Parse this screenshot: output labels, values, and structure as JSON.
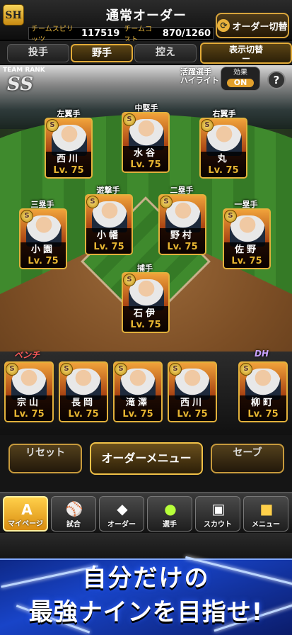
{
  "header": {
    "logo_text": "SH",
    "title": "通常オーダー",
    "team_spirit_label": "チームスピリッツ",
    "team_spirit_value": "117519",
    "team_cost_label": "チームコスト",
    "team_cost_value": "870/1260",
    "order_switch_label": "オーダー切替",
    "order_switch_icon": "cycle-arrows-icon"
  },
  "tabs": [
    {
      "label": "投手",
      "active": false
    },
    {
      "label": "野手",
      "active": true
    },
    {
      "label": "控え",
      "active": false
    }
  ],
  "view_switch": {
    "label": "表示切替",
    "value": "ー"
  },
  "field": {
    "team_rank_label": "TEAM RANK",
    "team_rank_value": "SS",
    "highlight_label_1": "活躍選手",
    "highlight_label_2": "ハイライト",
    "effect_label": "効果",
    "effect_value": "ON",
    "help_label": "?"
  },
  "lineup": [
    {
      "position": "左翼手",
      "name": "西川",
      "level": "Lv. 75"
    },
    {
      "position": "中堅手",
      "name": "水谷",
      "level": "Lv. 75"
    },
    {
      "position": "右翼手",
      "name": "丸",
      "level": "Lv. 75"
    },
    {
      "position": "三塁手",
      "name": "小園",
      "level": "Lv. 75"
    },
    {
      "position": "遊撃手",
      "name": "小幡",
      "level": "Lv. 75"
    },
    {
      "position": "二塁手",
      "name": "野村",
      "level": "Lv. 75"
    },
    {
      "position": "一塁手",
      "name": "佐野",
      "level": "Lv. 75"
    },
    {
      "position": "捕手",
      "name": "石伊",
      "level": "Lv. 75"
    }
  ],
  "bench": {
    "bench_label": "ベンチ",
    "dh_label": "DH",
    "players": [
      {
        "name": "宗山",
        "level": "Lv. 75"
      },
      {
        "name": "長岡",
        "level": "Lv. 75"
      },
      {
        "name": "滝澤",
        "level": "Lv. 75"
      },
      {
        "name": "西川",
        "level": "Lv. 75"
      },
      {
        "name": "柳町",
        "level": "Lv. 75"
      }
    ]
  },
  "badge_letter": "S",
  "actions": {
    "reset_label": "リセット",
    "menu_label": "オーダーメニュー",
    "save_label": "セーブ"
  },
  "nav": [
    {
      "label": "マイページ",
      "icon": "A-letter-icon"
    },
    {
      "label": "試合",
      "icon": "stadium-icon"
    },
    {
      "label": "オーダー",
      "icon": "diamond-field-icon"
    },
    {
      "label": "選手",
      "icon": "player-silhouette-icon"
    },
    {
      "label": "スカウト",
      "icon": "scout-card-icon"
    },
    {
      "label": "メニュー",
      "icon": "mascot-icon"
    }
  ],
  "promo": {
    "line1": "自分だけの",
    "line2": "最強ナインを目指せ!"
  },
  "colors": {
    "gold": "#e2b13c",
    "level_gold": "#e6b532",
    "promo_blue": "#1844c8",
    "grass": "#3f8a2d"
  }
}
